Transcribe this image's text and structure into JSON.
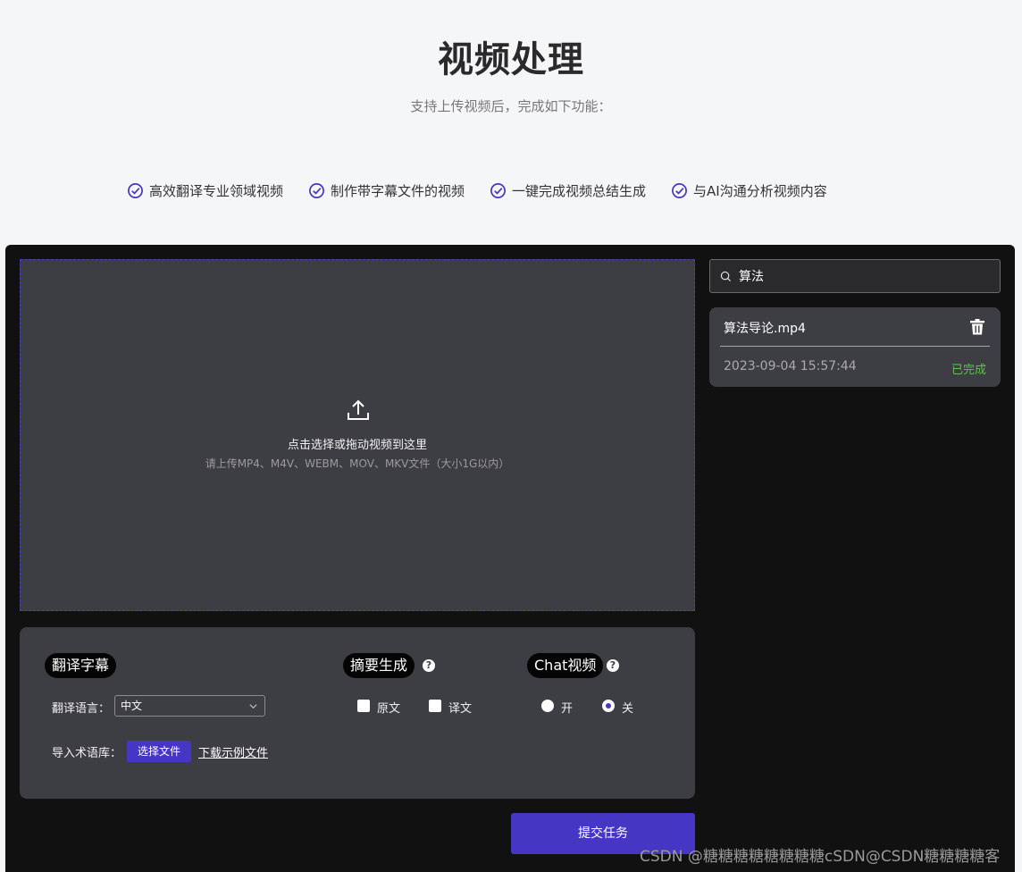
{
  "header": {
    "title": "视频处理",
    "subtitle": "支持上传视频后，完成如下功能："
  },
  "features": [
    "高效翻译专业领域视频",
    "制作带字幕文件的视频",
    "一键完成视频总结生成",
    "与AI沟通分析视频内容"
  ],
  "upload": {
    "main_text": "点击选择或拖动视频到这里",
    "hint": "请上传MP4、M4V、WEBM、MOV、MKV文件（大小1G以内）"
  },
  "options": {
    "translate": {
      "title": "翻译字幕",
      "language_label": "翻译语言：",
      "language_value": "中文",
      "glossary_label": "导入术语库：",
      "choose_file": "选择文件",
      "download_example": "下载示例文件"
    },
    "summary": {
      "title": "摘要生成",
      "original": "原文",
      "translated": "译文"
    },
    "chat": {
      "title": "Chat视频",
      "on": "开",
      "off": "关",
      "selected": "关"
    }
  },
  "submit_label": "提交任务",
  "search": {
    "value": "算法"
  },
  "files": [
    {
      "name": "算法导论.mp4",
      "time": "2023-09-04 15:57:44",
      "status": "已完成"
    }
  ],
  "colors": {
    "accent": "#4536c4",
    "success": "#5fc24b",
    "panel": "#111112",
    "card": "#3d3e43"
  },
  "watermark": "CSDN @糖糖糖糖糖糖糖糖cSDN@CSDN糖糖糖糖客"
}
